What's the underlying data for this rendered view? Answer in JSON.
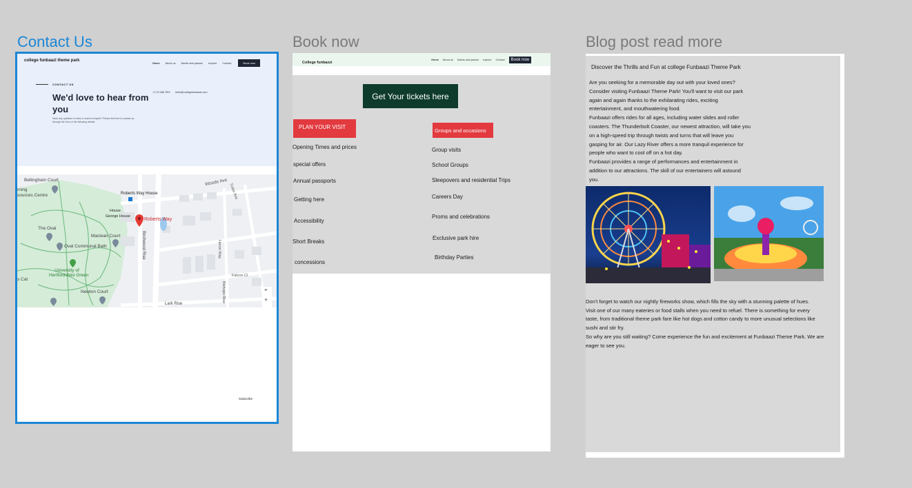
{
  "frames": [
    {
      "title": "Contact Us",
      "selected": true
    },
    {
      "title": "Book now",
      "selected": false
    },
    {
      "title": "Blog post read more",
      "selected": false
    }
  ],
  "contact": {
    "brand": "college funbaazi theme park",
    "nav": [
      "Home",
      "About us",
      "tickets and passes",
      "explore",
      "Contact"
    ],
    "book_now": "Book now",
    "eyebrow": "CONTACT US",
    "heading": "We'd love to hear from you",
    "subtext": "Have any question in mind or want to enquire? Please feel free to contact us through the form or the following details.",
    "phone": "+1 23 456 78%",
    "email": "hello@collegefunbaazi.com",
    "map": {
      "labels": [
        "Bellingham Court",
        "rning",
        "sources Centre",
        "Roberts Way House",
        "House",
        "George House",
        "Roberts Way",
        "Woods Ave",
        "The Oval",
        "Oval Communal Bath",
        "Maclean Court",
        "University of",
        "Hertfordshire Green",
        "s Cat",
        "Newton Court",
        "Birchwood Rise",
        "Lark Rise",
        "Falcon Cl",
        "Heron Way",
        "Bishops Rise",
        "Tudor Ave"
      ],
      "pin_color": "#e53935"
    },
    "subscribe": "Subscribe"
  },
  "book": {
    "brand": "College funbazzi",
    "nav": [
      "Home",
      "About us",
      "tickets and passes",
      "explore",
      "Contact"
    ],
    "book_now": "Book now",
    "tickets_button": "Get Your tickets here",
    "plan_button": "PLAN YOUR VISIT",
    "groups_button": "Groups and occasions",
    "left_items": [
      "Opening Times and prices",
      "special offers",
      "Annual passports",
      "Getting here",
      "Accessibility",
      "Short Breaks",
      "concessions"
    ],
    "right_items": [
      "Group visits",
      "School Groups",
      "Sleepovers and residential Trips",
      "Careers Day",
      "Proms and celebrations",
      "Exclusive park hire",
      "Birthday Parties"
    ],
    "colors": {
      "tickets_bg": "#0e3b2c",
      "red": "#e23a3f"
    }
  },
  "blog": {
    "title": "Discover the Thrills and Fun at college Funbaazi Theme Park",
    "para1_lines": [
      "Are you seeking for a memorable day out with your loved ones?",
      "Consider visiting Funbaazi Theme Park! You'll want to visit our park",
      "again and again thanks to the exhilarating rides, exciting",
      "entertainment, and mouthwatering food.",
      "Funbaazi offers rides for all ages, including water slides and roller",
      "coasters. The Thunderbolt Coaster, our newest attraction, will take you",
      "on a high-speed trip through twists and turns that will leave you",
      "gasping for air. Our Lazy River offers a more tranquil experience for",
      "people who want to cool off on a hot day.",
      "Funbaazi provides a range of performances and entertainment in",
      "addition to our attractions. The skill of our entertainers will astound",
      "you."
    ],
    "para2_lines": [
      "Don't forget to watch our nightly fireworks show, which fills the sky with a stunning palette of hues.",
      "Visit one of our many eateries or food stalls when you need to refuel. There is something for every",
      "taste, from traditional theme park fare like hot dogs and cotton candy to more unusual selections like",
      "sushi and stir fry.",
      "So why are you still waiting? Come experience the fun and excitement at Funbaazi Theme Park. We are",
      "eager to see you."
    ]
  }
}
